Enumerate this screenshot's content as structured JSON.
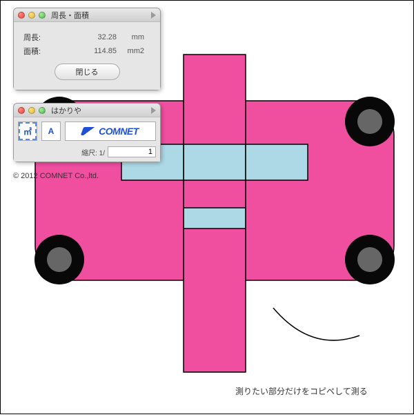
{
  "panel1": {
    "title": "周長・面積",
    "perimeter_label": "周長:",
    "perimeter_value": "32.28",
    "perimeter_unit": "mm",
    "area_label": "面積:",
    "area_value": "114.85",
    "area_unit": "mm2",
    "close_label": "閉じる"
  },
  "panel2": {
    "title": "はかりや",
    "tool_m_label": "㎡",
    "tool_a_label": "A",
    "logo_text": "COMNET",
    "scale_label": "縮尺: 1/",
    "scale_value": "1"
  },
  "copyright": "© 2012 COMNET Co.,ltd.",
  "caption": "測りたい部分だけをコピペして測る",
  "colors": {
    "pink": "#f04fa0",
    "cyan": "#add9e6",
    "black": "#080808",
    "grey": "#666666"
  }
}
